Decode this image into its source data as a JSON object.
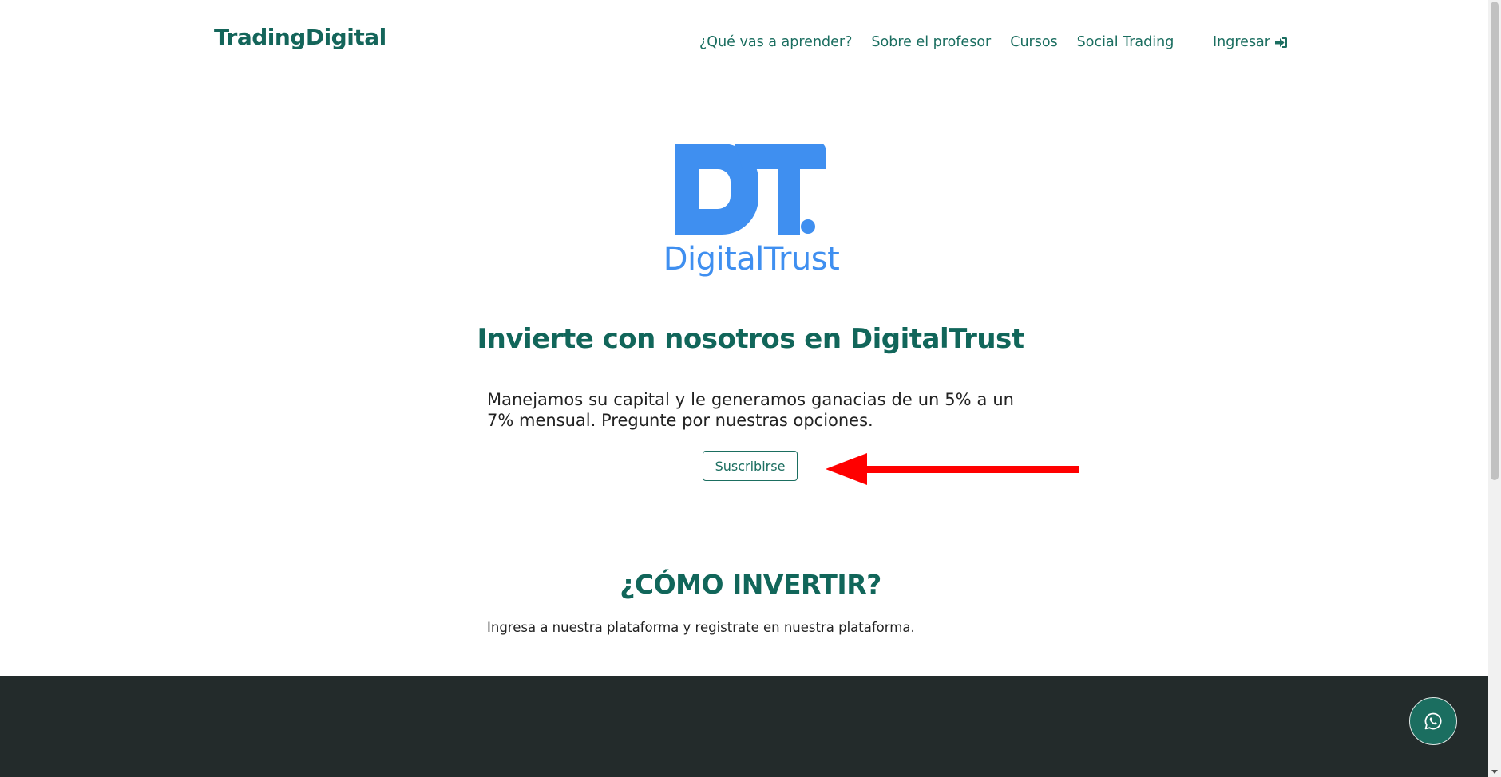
{
  "navbar": {
    "brand": "TradingDigital",
    "links": [
      "¿Qué vas a aprender?",
      "Sobre el profesor",
      "Cursos",
      "Social Trading"
    ],
    "login_label": "Ingresar",
    "login_icon": "sign-in-icon"
  },
  "logo": {
    "text": "DigitalTrust",
    "color": "#3f8ff0"
  },
  "hero": {
    "title": "Invierte con nosotros en DigitalTrust",
    "text": "Manejamos su capital y le generamos ganacias de un 5% a un 7% mensual. Pregunte por nuestras opciones.",
    "button_label": "Suscribirse"
  },
  "annotation": {
    "arrow_color": "#ff0000"
  },
  "how_to": {
    "title": "¿CÓMO INVERTIR?",
    "text": "Ingresa a nuestra plataforma y registrate en nuestra plataforma."
  },
  "colors": {
    "brand": "#14655a",
    "footer": "#232b2b"
  },
  "floating": {
    "icon": "whatsapp-icon"
  }
}
